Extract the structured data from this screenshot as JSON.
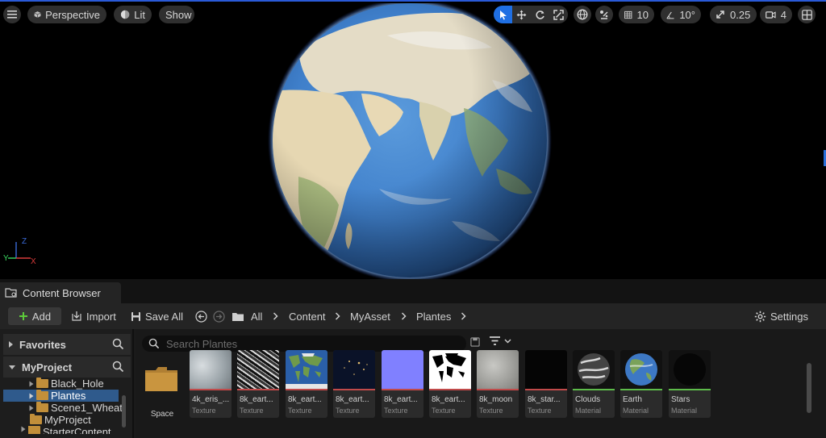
{
  "viewport": {
    "perspective_label": "Perspective",
    "lit_label": "Lit",
    "show_label": "Show",
    "grid_snap_value": "10",
    "rotation_snap_value": "10°",
    "scale_snap_value": "0.25",
    "camera_speed_value": "4",
    "axis": {
      "z": "Z",
      "y": "Y",
      "x": "X"
    }
  },
  "content_browser": {
    "tab_label": "Content Browser",
    "toolbar": {
      "add_label": "Add",
      "import_label": "Import",
      "save_all_label": "Save All",
      "settings_label": "Settings"
    },
    "breadcrumb": [
      "All",
      "Content",
      "MyAsset",
      "Plantes"
    ],
    "sidebar": {
      "favorites_label": "Favorites",
      "project_label": "MyProject",
      "tree": [
        {
          "label": "Black_Hole"
        },
        {
          "label": "Plantes",
          "selected": true
        },
        {
          "label": "Scene1_Wheat"
        },
        {
          "label": "MyProject"
        },
        {
          "label": "StarterContent"
        }
      ]
    },
    "search": {
      "placeholder": "Search Plantes",
      "value": ""
    },
    "folder": {
      "label": "Space"
    },
    "assets": [
      {
        "name": "4k_eris_...",
        "type": "Texture",
        "bar_color": "#c14a4a"
      },
      {
        "name": "8k_eart...",
        "type": "Texture",
        "bar_color": "#c14a4a"
      },
      {
        "name": "8k_eart...",
        "type": "Texture",
        "bar_color": "#c14a4a"
      },
      {
        "name": "8k_eart...",
        "type": "Texture",
        "bar_color": "#c14a4a"
      },
      {
        "name": "8k_eart...",
        "type": "Texture",
        "bar_color": "#c14a4a"
      },
      {
        "name": "8k_eart...",
        "type": "Texture",
        "bar_color": "#c14a4a"
      },
      {
        "name": "8k_moon",
        "type": "Texture",
        "bar_color": "#c14a4a"
      },
      {
        "name": "8k_star...",
        "type": "Texture",
        "bar_color": "#c14a4a"
      },
      {
        "name": "Clouds",
        "type": "Material",
        "bar_color": "#5dbb4a"
      },
      {
        "name": "Earth",
        "type": "Material",
        "bar_color": "#5dbb4a"
      },
      {
        "name": "Stars",
        "type": "Material",
        "bar_color": "#5dbb4a"
      }
    ],
    "colors": {
      "accent": "#1f6fe3",
      "selection": "#2f5a8c",
      "folder": "#c28f3a"
    }
  }
}
